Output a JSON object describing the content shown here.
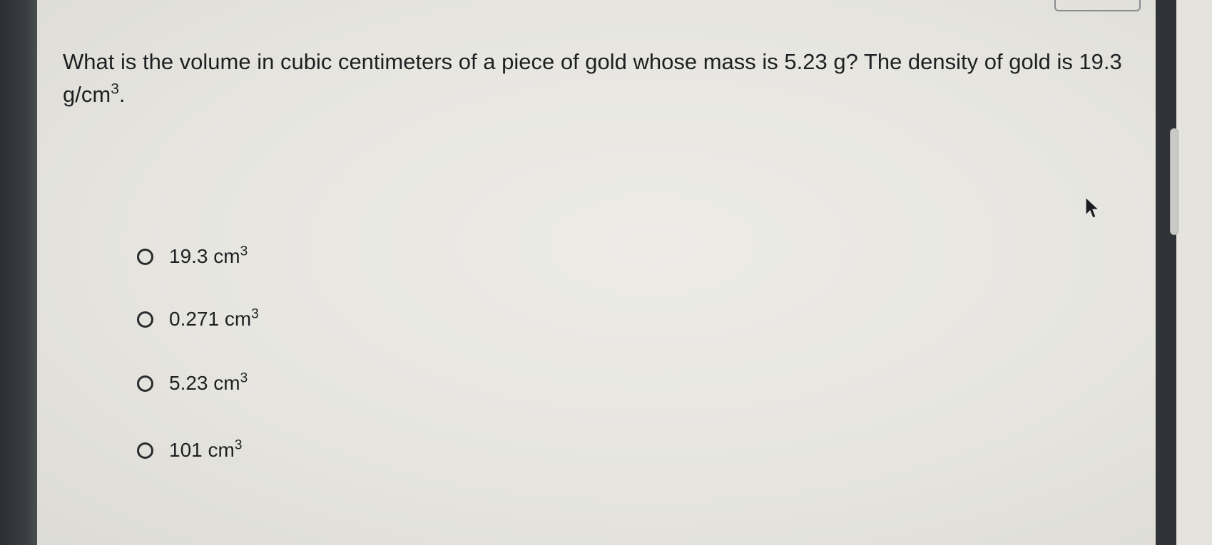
{
  "question": {
    "text_before": "What is the volume in cubic centimeters of a piece of gold whose mass is 5.23 g? The density of gold is 19.3 g/cm",
    "superscript": "3",
    "text_after": "."
  },
  "options": [
    {
      "value": "19.3 cm",
      "sup": "3",
      "selected": false
    },
    {
      "value": "0.271 cm",
      "sup": "3",
      "selected": false
    },
    {
      "value": "5.23 cm",
      "sup": "3",
      "selected": false
    },
    {
      "value": "101 cm",
      "sup": "3",
      "selected": false
    }
  ],
  "icons": {
    "radio": "radio-unselected-icon",
    "cursor": "mouse-pointer-icon"
  },
  "colors": {
    "text": "#1e1f22",
    "screen_bg": "#e8e7e2",
    "bezel": "#2f3236"
  }
}
